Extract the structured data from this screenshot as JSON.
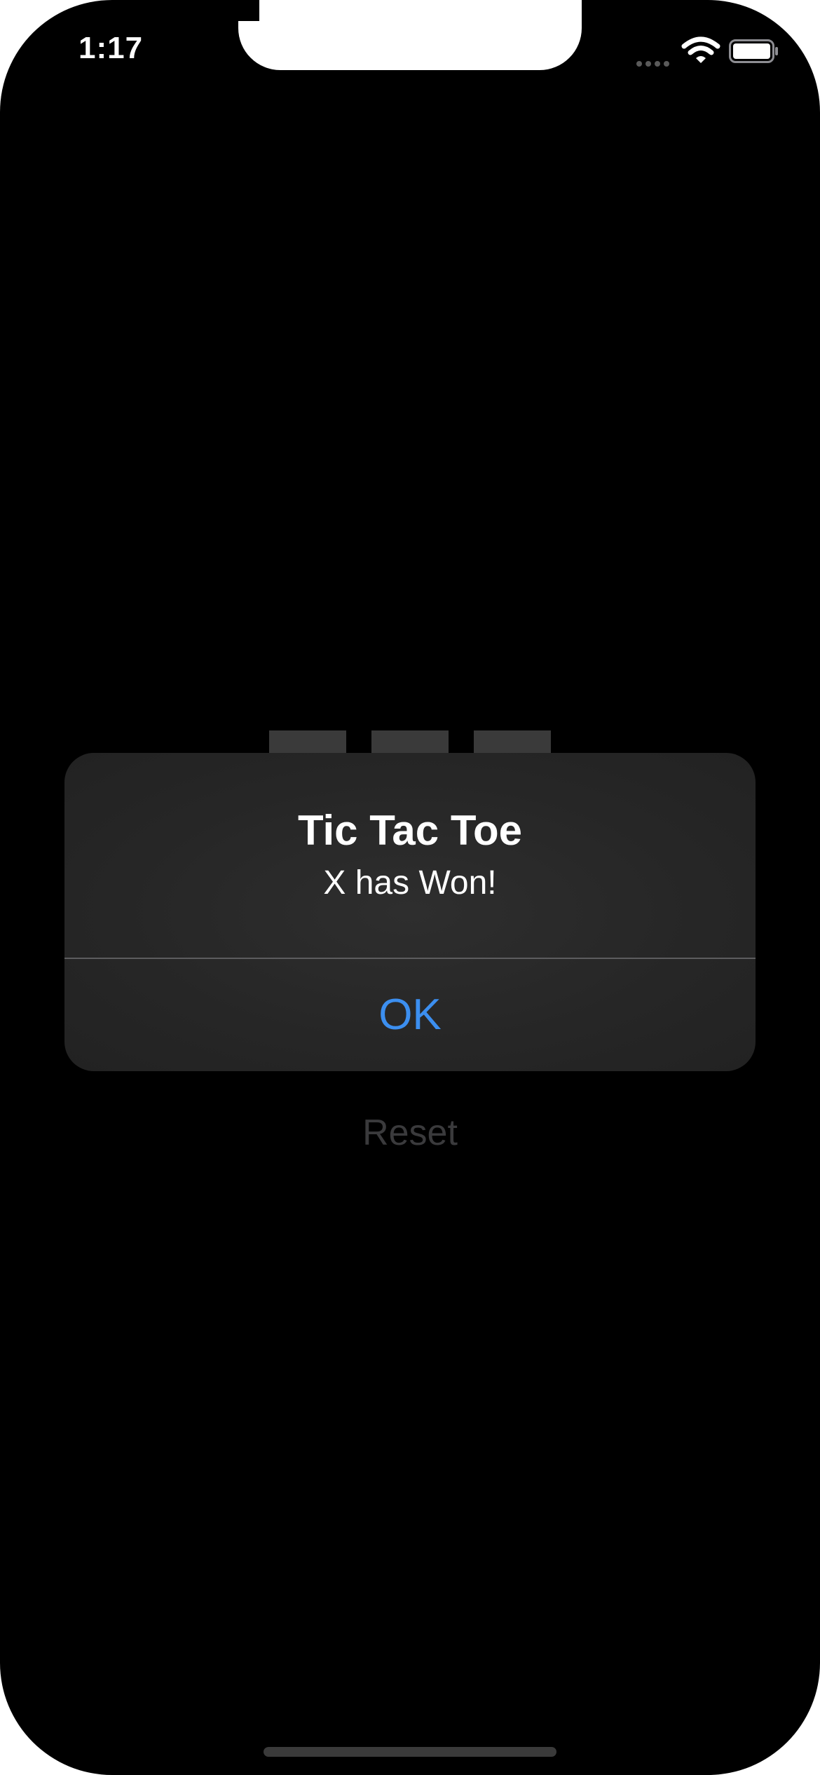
{
  "status_bar": {
    "time": "1:17",
    "wifi_icon": "wifi-icon",
    "battery_icon": "battery-icon",
    "signal_icon": "signal-dots-icon"
  },
  "game": {
    "reset_label": "Reset"
  },
  "alert": {
    "title": "Tic Tac Toe",
    "message": "X has Won!",
    "ok_label": "OK"
  },
  "colors": {
    "background": "#000000",
    "alert_bg": "#2b2b2b",
    "accent": "#3c8ff0",
    "tile": "#3a3a3a",
    "reset_disabled": "#3a3a3c"
  }
}
